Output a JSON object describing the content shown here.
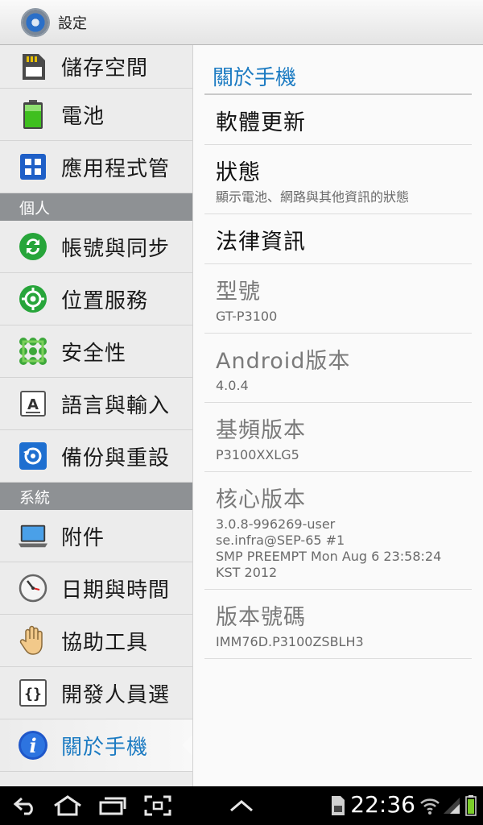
{
  "titlebar": {
    "title": "設定",
    "icon": "settings-gear-icon"
  },
  "left_menu": {
    "items_top": [
      {
        "label": "儲存空間",
        "icon": "sd-card-icon"
      },
      {
        "label": "電池",
        "icon": "battery-icon"
      },
      {
        "label": "應用程式管",
        "icon": "apps-grid-icon"
      }
    ],
    "section_personal": "個人",
    "items_personal": [
      {
        "label": "帳號與同步",
        "icon": "sync-icon"
      },
      {
        "label": "位置服務",
        "icon": "location-icon"
      },
      {
        "label": "安全性",
        "icon": "security-pattern-icon"
      },
      {
        "label": "語言與輸入",
        "icon": "keyboard-a-icon"
      },
      {
        "label": "備份與重設",
        "icon": "backup-restore-icon"
      }
    ],
    "section_system": "系統",
    "items_system": [
      {
        "label": "附件",
        "icon": "laptop-accessory-icon"
      },
      {
        "label": "日期與時間",
        "icon": "clock-icon"
      },
      {
        "label": "協助工具",
        "icon": "hand-icon"
      },
      {
        "label": "開發人員選",
        "icon": "braces-icon"
      },
      {
        "label": "關於手機",
        "icon": "info-icon"
      }
    ]
  },
  "about": {
    "header": "關於手機",
    "items": [
      {
        "title": "軟體更新",
        "sub": ""
      },
      {
        "title": "狀態",
        "sub": "顯示電池、網路與其他資訊的狀態"
      },
      {
        "title": "法律資訊",
        "sub": ""
      },
      {
        "title": "型號",
        "sub": "GT-P3100"
      },
      {
        "title": "Android版本",
        "sub": "4.0.4"
      },
      {
        "title": "基頻版本",
        "sub": "P3100XXLG5"
      },
      {
        "title": "核心版本",
        "sub": "3.0.8-996269-user\nse.infra@SEP-65 #1\nSMP PREEMPT Mon Aug 6 23:58:24\nKST 2012"
      },
      {
        "title": "版本號碼",
        "sub": "IMM76D.P3100ZSBLH3"
      }
    ]
  },
  "statusbar": {
    "time": "22:36"
  },
  "colors": {
    "accent": "#1c7bc2",
    "section_bg": "#8e9194"
  }
}
